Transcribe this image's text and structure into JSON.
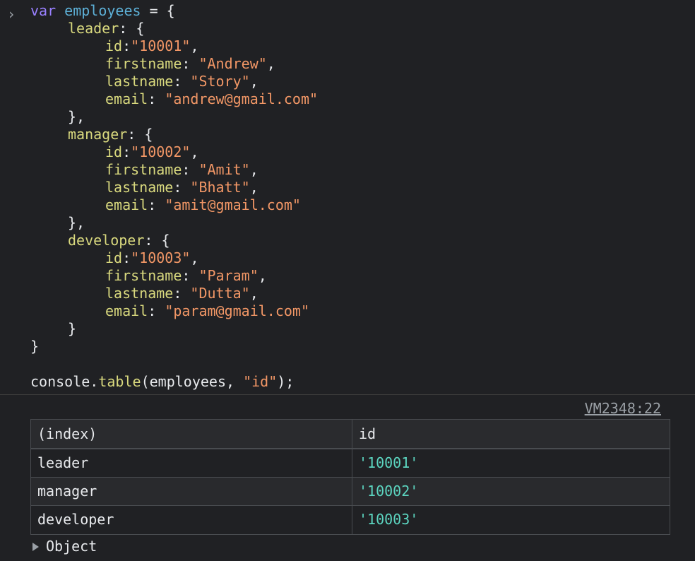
{
  "prompt_symbol": "›",
  "code": {
    "line1": {
      "kw": "var",
      "name": "employees",
      "rest": " = {"
    },
    "leader": {
      "key": "leader",
      "id_key": "id",
      "id_val": "\"10001\"",
      "firstname_key": "firstname",
      "firstname_val": "\"Andrew\"",
      "lastname_key": "lastname",
      "lastname_val": "\"Story\"",
      "email_key": "email",
      "email_val": "\"andrew@gmail.com\""
    },
    "manager": {
      "key": "manager",
      "id_key": "id",
      "id_val": "\"10002\"",
      "firstname_key": "firstname",
      "firstname_val": "\"Amit\"",
      "lastname_key": "lastname",
      "lastname_val": "\"Bhatt\"",
      "email_key": "email",
      "email_val": "\"amit@gmail.com\""
    },
    "developer": {
      "key": "developer",
      "id_key": "id",
      "id_val": "\"10003\"",
      "firstname_key": "firstname",
      "firstname_val": "\"Param\"",
      "lastname_key": "lastname",
      "lastname_val": "\"Dutta\"",
      "email_key": "email",
      "email_val": "\"param@gmail.com\""
    },
    "call": {
      "obj": "console",
      "fn": "table",
      "arg1": "employees",
      "arg2": "\"id\""
    }
  },
  "output": {
    "source": "VM2348:22",
    "table": {
      "headers": [
        "(index)",
        "id"
      ],
      "rows": [
        {
          "index": "leader",
          "id": "'10001'"
        },
        {
          "index": "manager",
          "id": "'10002'"
        },
        {
          "index": "developer",
          "id": "'10003'"
        }
      ]
    },
    "object_label": "Object"
  }
}
